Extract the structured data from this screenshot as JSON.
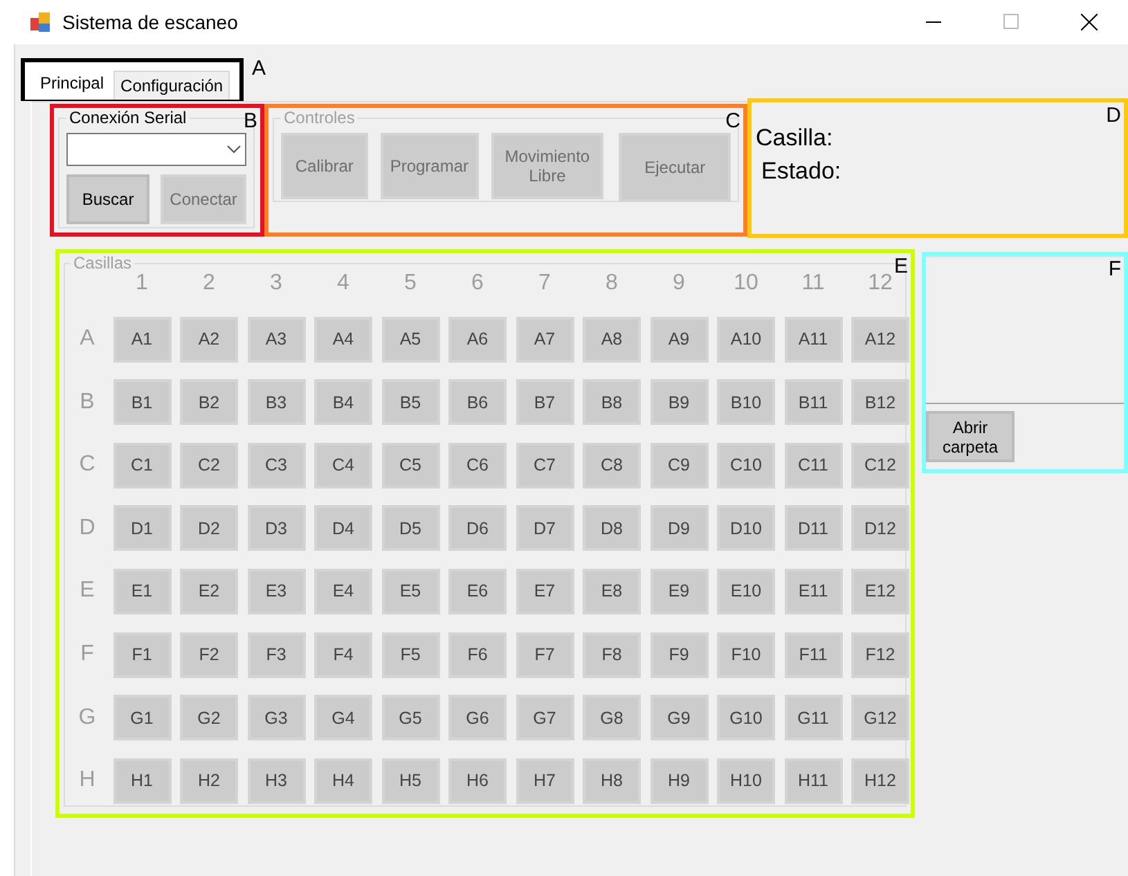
{
  "window": {
    "title": "Sistema de escaneo"
  },
  "tabs": {
    "marker": {
      "label": "A",
      "color": "#000000"
    },
    "items": [
      {
        "label": "Principal",
        "selected": true
      },
      {
        "label": "Configuración",
        "selected": false
      }
    ]
  },
  "serial": {
    "marker": {
      "label": "B",
      "color": "#e81123"
    },
    "title": "Conexión Serial",
    "buttons": [
      {
        "label": "Buscar",
        "disabled": false
      },
      {
        "label": "Conectar",
        "disabled": true
      }
    ]
  },
  "controls": {
    "marker": {
      "label": "C",
      "color": "#ff7f27"
    },
    "title": "Controles",
    "disabled": true,
    "buttons": [
      "Calibrar",
      "Programar",
      "Movimiento Libre",
      "Ejecutar"
    ]
  },
  "status": {
    "marker": {
      "label": "D",
      "color": "#ffc90e"
    },
    "labels": [
      "Casilla:",
      "Estado:"
    ]
  },
  "casillas": {
    "marker": {
      "label": "E",
      "color": "#ccff00"
    },
    "title": "Casillas",
    "disabled": true,
    "columns": [
      "1",
      "2",
      "3",
      "4",
      "5",
      "6",
      "7",
      "8",
      "9",
      "10",
      "11",
      "12"
    ],
    "rows": [
      {
        "label": "A",
        "cells": [
          "A1",
          "A2",
          "A3",
          "A4",
          "A5",
          "A6",
          "A7",
          "A8",
          "A9",
          "A10",
          "A11",
          "A12"
        ]
      },
      {
        "label": "B",
        "cells": [
          "B1",
          "B2",
          "B3",
          "B4",
          "B5",
          "B6",
          "B7",
          "B8",
          "B9",
          "B10",
          "B11",
          "B12"
        ]
      },
      {
        "label": "C",
        "cells": [
          "C1",
          "C2",
          "C3",
          "C4",
          "C5",
          "C6",
          "C7",
          "C8",
          "C9",
          "C10",
          "C11",
          "C12"
        ]
      },
      {
        "label": "D",
        "cells": [
          "D1",
          "D2",
          "D3",
          "D4",
          "D5",
          "D6",
          "D7",
          "D8",
          "D9",
          "D10",
          "D11",
          "D12"
        ]
      },
      {
        "label": "E",
        "cells": [
          "E1",
          "E2",
          "E3",
          "E4",
          "E5",
          "E6",
          "E7",
          "E8",
          "E9",
          "E10",
          "E11",
          "E12"
        ]
      },
      {
        "label": "F",
        "cells": [
          "F1",
          "F2",
          "F3",
          "F4",
          "F5",
          "F6",
          "F7",
          "F8",
          "F9",
          "F10",
          "F11",
          "F12"
        ]
      },
      {
        "label": "G",
        "cells": [
          "G1",
          "G2",
          "G3",
          "G4",
          "G5",
          "G6",
          "G7",
          "G8",
          "G9",
          "G10",
          "G11",
          "G12"
        ]
      },
      {
        "label": "H",
        "cells": [
          "H1",
          "H2",
          "H3",
          "H4",
          "H5",
          "H6",
          "H7",
          "H8",
          "H9",
          "H10",
          "H11",
          "H12"
        ]
      }
    ]
  },
  "folder": {
    "marker": {
      "label": "F",
      "color": "#80ffff"
    },
    "button": "Abrir carpeta"
  }
}
